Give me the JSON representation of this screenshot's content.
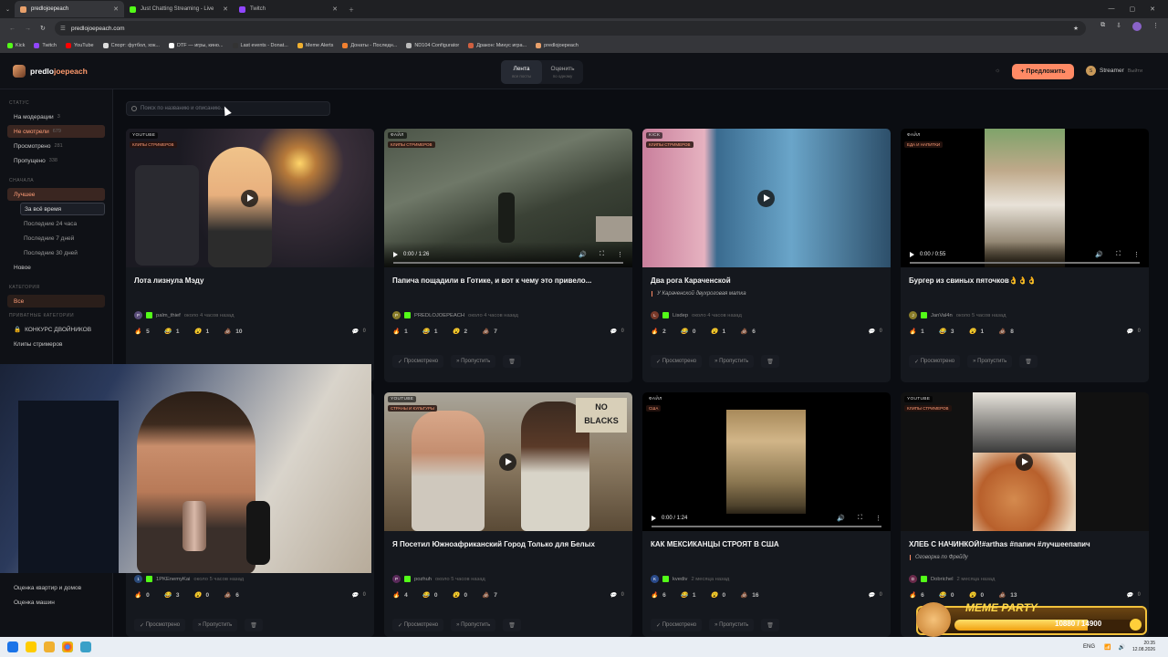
{
  "browser": {
    "tabs": [
      {
        "label": "predlojoepeach",
        "active": true
      },
      {
        "label": "Just Chatting Streaming - Live",
        "active": false
      },
      {
        "label": "Twitch",
        "active": false
      }
    ],
    "url": "predlojoepeach.com",
    "bookmarks": [
      "Kick",
      "Twitch",
      "YouTube",
      "Спорт: футбол, хок...",
      "DTF — игры, кино...",
      "Last events - Donat...",
      "Meme Alerts",
      "Донаты - Последн...",
      "ND104 Configurator",
      "Дракон: Минус игра...",
      "predlojoepeach"
    ]
  },
  "header": {
    "logo_prefix": "predlo",
    "logo_suffix": "joepeach",
    "tabs": [
      {
        "label": "Лента",
        "sub": "все посты"
      },
      {
        "label": "Оценить",
        "sub": "по одному"
      }
    ],
    "propose_label": "+ Предложить",
    "user_initial": "S",
    "user_name": "Streamer",
    "logout_label": "Выйти"
  },
  "sidebar": {
    "status_heading": "СТАТУС",
    "status": [
      {
        "label": "На модерации",
        "count": "3"
      },
      {
        "label": "Не смотрели",
        "count": "679"
      },
      {
        "label": "Просмотрено",
        "count": "281"
      },
      {
        "label": "Пропущено",
        "count": "338"
      }
    ],
    "sort_heading": "СНАЧАЛА",
    "best_label": "Лучшее",
    "periods": [
      "За всё время",
      "Последние 24 часа",
      "Последние 7 дней",
      "Последние 30 дней"
    ],
    "new_label": "Новое",
    "cat_heading": "КАТЕГОРИЯ",
    "all_label": "Все",
    "private_heading": "ПРИВАТНЫЕ КАТЕГОРИИ",
    "contest_label": "КОНКУРС ДВОЙНИКОВ",
    "clips_label": "Клипы стримеров",
    "bottom_items": [
      "Оценка квартир и домов",
      "Оценка машин"
    ]
  },
  "search": {
    "placeholder": "Поиск по названию и описанию..."
  },
  "cards": [
    {
      "source": "YOUTUBE",
      "category": "КЛИПЫ СТРИМЕРОВ",
      "title": "Лота лизнула Мэду",
      "desc": "",
      "author_initial": "P",
      "author": "palm_thief",
      "ago": "около 4 часов назад",
      "reactions": [
        "5",
        "1",
        "1",
        "10"
      ],
      "comments": "0",
      "video_time": ""
    },
    {
      "source": "ФАЙЛ",
      "category": "КЛИПЫ СТРИМЕРОВ",
      "title": "Папича пощадили в Готике, и вот к чему это привело...",
      "desc": "",
      "author_initial": "P",
      "author": "PREDLOJOEPEACH",
      "ago": "около 4 часов назад",
      "reactions": [
        "1",
        "1",
        "2",
        "7"
      ],
      "comments": "0",
      "video_time": "0:00 / 1:26"
    },
    {
      "source": "KICK",
      "category": "КЛИПЫ СТРИМЕРОВ",
      "title": "Два рога Караченской",
      "desc": "У Караченской двухроговая матка",
      "author_initial": "L",
      "author": "Lisdep",
      "ago": "около 4 часов назад",
      "reactions": [
        "2",
        "0",
        "1",
        "6"
      ],
      "comments": "0",
      "video_time": ""
    },
    {
      "source": "ФАЙЛ",
      "category": "ЕДА И НАПИТКИ",
      "title": "Бургер из свиных пяточков👌👌👌",
      "desc": "",
      "author_initial": "J",
      "author": "JanVal4n",
      "ago": "около 5 часов назад",
      "reactions": [
        "1",
        "3",
        "1",
        "8"
      ],
      "comments": "0",
      "video_time": "0:00 / 0:55"
    },
    {
      "source": "",
      "category": "",
      "title": "",
      "desc": "",
      "author_initial": "1",
      "author": "1PKEnemyKai",
      "ago": "около 5 часов назад",
      "reactions": [
        "0",
        "3",
        "0",
        "6"
      ],
      "comments": "0",
      "video_time": ""
    },
    {
      "source": "YOUTUBE",
      "category": "СТРАНЫ И КУЛЬТУРЫ",
      "title": "Я Посетил Южноафриканский Город Только для Белых",
      "desc": "",
      "author_initial": "P",
      "author": "pozhuh",
      "ago": "около 5 часов назад",
      "reactions": [
        "4",
        "0",
        "0",
        "7"
      ],
      "comments": "0",
      "video_time": ""
    },
    {
      "source": "ФАЙЛ",
      "category": "США",
      "title": "КАК МЕКСИКАНЦЫ СТРОЯТ В США",
      "desc": "",
      "author_initial": "K",
      "author": "kvediv",
      "ago": "2 месяца назад",
      "reactions": [
        "6",
        "1",
        "0",
        "16"
      ],
      "comments": "0",
      "video_time": "0:00 / 1:24"
    },
    {
      "source": "YOUTUBE",
      "category": "КЛИПЫ СТРИМЕРОВ",
      "title": "ХЛЕБ С НАЧИНКОЙ!#arthas #папич #лучшеепапич",
      "desc": "Оговорка по Фрейду",
      "author_initial": "D",
      "author": "Dobrichel",
      "ago": "2 месяца назад",
      "reactions": [
        "6",
        "0",
        "0",
        "13"
      ],
      "comments": "0",
      "video_time": ""
    }
  ],
  "card_actions": [
    "Просмотрено",
    "Пропустить"
  ],
  "no_blacks_sign": [
    "NO",
    "BLACKS"
  ],
  "meme_party": {
    "title": "MEME PARTY",
    "progress": "10880 / 14900",
    "progress_ratio": 0.73
  },
  "taskbar": {
    "lang": "ENG",
    "time": "20:35",
    "date": "12.08.2026"
  },
  "colors": {
    "accent": "#ff8a65",
    "kick_green": "#53fc18",
    "bg": "#0b0d12"
  }
}
